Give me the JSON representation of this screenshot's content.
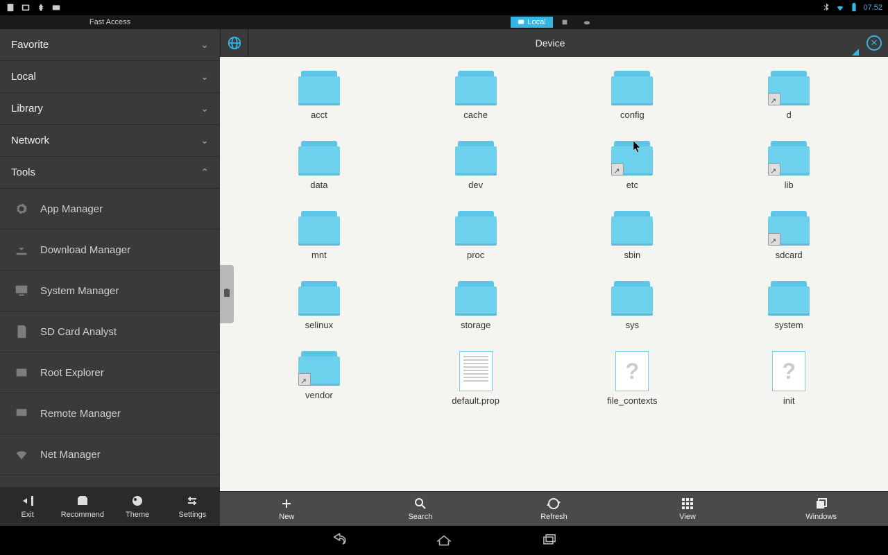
{
  "status": {
    "time": "07.52"
  },
  "tabs": {
    "local": "Local"
  },
  "sidebar": {
    "title": "Fast Access",
    "sections": [
      {
        "label": "Favorite",
        "expanded": false
      },
      {
        "label": "Local",
        "expanded": false
      },
      {
        "label": "Library",
        "expanded": false
      },
      {
        "label": "Network",
        "expanded": false
      },
      {
        "label": "Tools",
        "expanded": true
      }
    ],
    "tools": [
      {
        "label": "App Manager",
        "icon": "gear"
      },
      {
        "label": "Download Manager",
        "icon": "download"
      },
      {
        "label": "System Manager",
        "icon": "system"
      },
      {
        "label": "SD Card Analyst",
        "icon": "sdcard"
      },
      {
        "label": "Root Explorer",
        "icon": "root"
      },
      {
        "label": "Remote Manager",
        "icon": "remote"
      },
      {
        "label": "Net Manager",
        "icon": "wifi"
      }
    ],
    "bottom": [
      {
        "label": "Exit"
      },
      {
        "label": "Recommend"
      },
      {
        "label": "Theme"
      },
      {
        "label": "Settings"
      }
    ]
  },
  "path": {
    "title": "Device"
  },
  "files": [
    {
      "name": "acct",
      "type": "folder"
    },
    {
      "name": "cache",
      "type": "folder"
    },
    {
      "name": "config",
      "type": "folder"
    },
    {
      "name": "d",
      "type": "folder-link"
    },
    {
      "name": "data",
      "type": "folder"
    },
    {
      "name": "dev",
      "type": "folder"
    },
    {
      "name": "etc",
      "type": "folder-link"
    },
    {
      "name": "lib",
      "type": "folder-link"
    },
    {
      "name": "mnt",
      "type": "folder"
    },
    {
      "name": "proc",
      "type": "folder"
    },
    {
      "name": "sbin",
      "type": "folder"
    },
    {
      "name": "sdcard",
      "type": "folder-link"
    },
    {
      "name": "selinux",
      "type": "folder"
    },
    {
      "name": "storage",
      "type": "folder"
    },
    {
      "name": "sys",
      "type": "folder"
    },
    {
      "name": "system",
      "type": "folder"
    },
    {
      "name": "vendor",
      "type": "folder-link"
    },
    {
      "name": "default.prop",
      "type": "doc"
    },
    {
      "name": "file_contexts",
      "type": "unknown"
    },
    {
      "name": "init",
      "type": "unknown"
    }
  ],
  "bottombar": [
    {
      "label": "New"
    },
    {
      "label": "Search"
    },
    {
      "label": "Refresh"
    },
    {
      "label": "View"
    },
    {
      "label": "Windows"
    }
  ]
}
